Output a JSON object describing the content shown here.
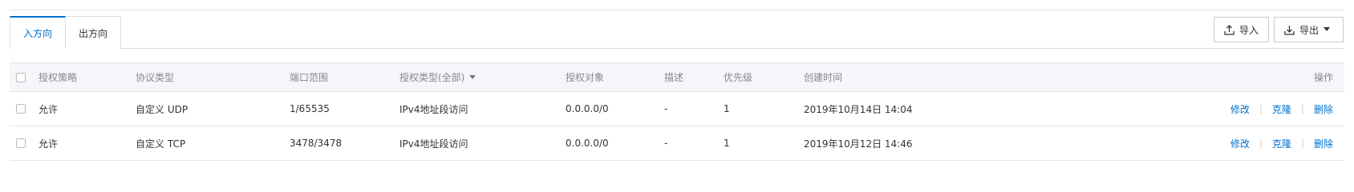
{
  "tabs": [
    {
      "label": "入方向",
      "active": true
    },
    {
      "label": "出方向",
      "active": false
    }
  ],
  "toolbar": {
    "import_label": "导入",
    "export_label": "导出",
    "import_icon": "upload-icon",
    "export_icon": "download-icon"
  },
  "table": {
    "headers": {
      "policy": "授权策略",
      "protocol": "协议类型",
      "port": "端口范围",
      "auth_type": "授权类型(全部)",
      "auth_object": "授权对象",
      "description": "描述",
      "priority": "优先级",
      "created": "创建时间",
      "operations": "操作"
    },
    "rows": [
      {
        "policy": "允许",
        "protocol": "自定义 UDP",
        "port": "1/65535",
        "auth_type": "IPv4地址段访问",
        "auth_object": "0.0.0.0/0",
        "description": "-",
        "priority": "1",
        "created": "2019年10月14日 14:04",
        "actions": {
          "edit": "修改",
          "clone": "克隆",
          "delete": "删除"
        }
      },
      {
        "policy": "允许",
        "protocol": "自定义 TCP",
        "port": "3478/3478",
        "auth_type": "IPv4地址段访问",
        "auth_object": "0.0.0.0/0",
        "description": "-",
        "priority": "1",
        "created": "2019年10月12日 14:46",
        "actions": {
          "edit": "修改",
          "clone": "克隆",
          "delete": "删除"
        }
      }
    ]
  },
  "colors": {
    "accent": "#0070cc",
    "header_bg": "#f5f6fa",
    "border": "#e5e5e5"
  }
}
